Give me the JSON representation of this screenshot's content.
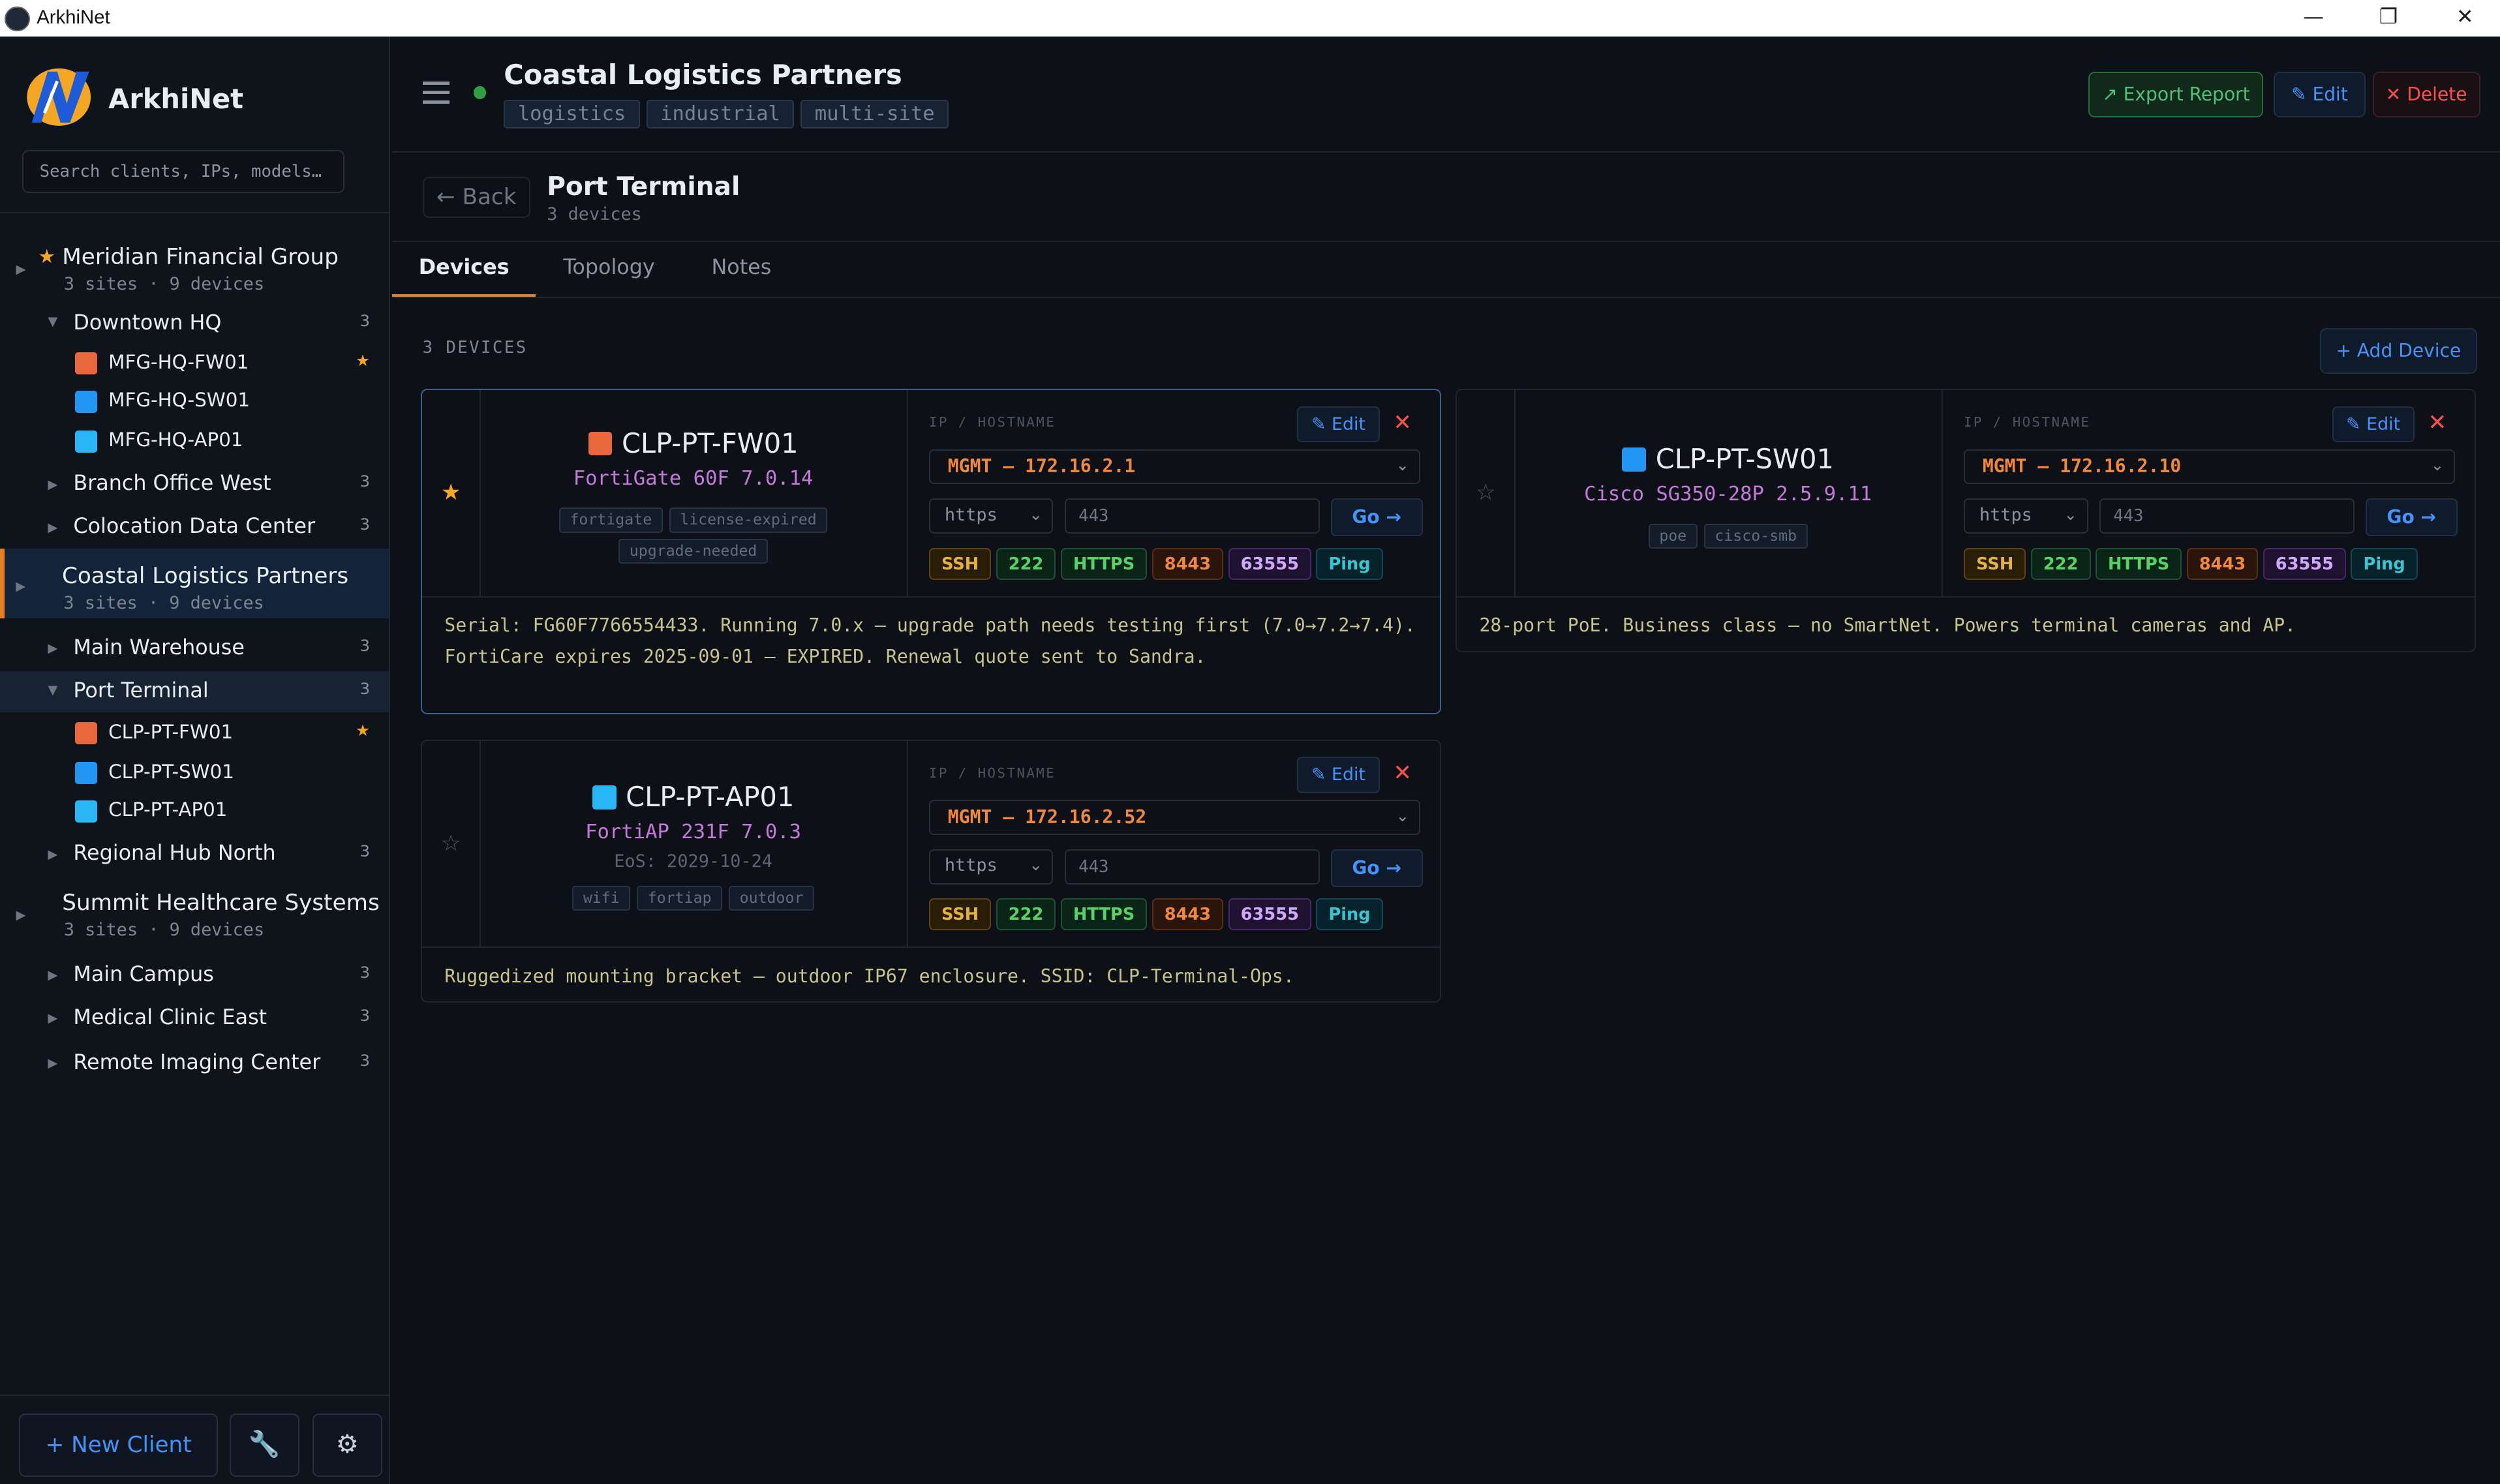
{
  "window": {
    "title": "ArkhiNet",
    "minimize": "—",
    "maximize": "❐",
    "close": "✕"
  },
  "sidebar": {
    "brand": "ArkhiNet",
    "search_placeholder": "Search clients, IPs, models…",
    "clients": [
      {
        "name": "Meridian Financial Group",
        "meta": "3 sites · 9 devices",
        "starred": true
      },
      {
        "name": "Coastal Logistics Partners",
        "meta": "3 sites · 9 devices",
        "starred": false
      },
      {
        "name": "Summit Healthcare Systems",
        "meta": "3 sites · 9 devices",
        "starred": false
      }
    ],
    "sites": {
      "downtown_hq": {
        "name": "Downtown HQ",
        "count": "3"
      },
      "branch_office_west": {
        "name": "Branch Office West",
        "count": "3"
      },
      "colocation": {
        "name": "Colocation Data Center",
        "count": "3"
      },
      "main_warehouse": {
        "name": "Main Warehouse",
        "count": "3"
      },
      "port_terminal": {
        "name": "Port Terminal",
        "count": "3"
      },
      "regional_hub_north": {
        "name": "Regional Hub North",
        "count": "3"
      },
      "main_campus": {
        "name": "Main Campus",
        "count": "3"
      },
      "medical_clinic_east": {
        "name": "Medical Clinic East",
        "count": "3"
      },
      "remote_imaging": {
        "name": "Remote Imaging Center",
        "count": "3"
      }
    },
    "devices": {
      "mfg_fw": "MFG-HQ-FW01",
      "mfg_sw": "MFG-HQ-SW01",
      "mfg_ap": "MFG-HQ-AP01",
      "clp_fw": "CLP-PT-FW01",
      "clp_sw": "CLP-PT-SW01",
      "clp_ap": "CLP-PT-AP01"
    },
    "footer": {
      "new_client": "+ New Client",
      "tools_icon": "🔧",
      "settings_icon": "⚙"
    }
  },
  "header": {
    "title": "Coastal Logistics Partners",
    "tags": [
      "logistics",
      "industrial",
      "multi-site"
    ],
    "export_label": "↗ Export Report",
    "edit_label": "✎ Edit",
    "delete_label": "✕ Delete"
  },
  "site": {
    "back_label": "← Back",
    "title": "Port Terminal",
    "subtitle": "3 devices"
  },
  "tabs": [
    "Devices",
    "Topology",
    "Notes"
  ],
  "devices_section": {
    "count_label": "3 DEVICES",
    "add_label": "+ Add Device"
  },
  "cards": [
    {
      "name": "CLP-PT-FW01",
      "model": "FortiGate 60F 7.0.14",
      "eos": "",
      "starred": true,
      "tags": [
        "fortigate",
        "license-expired",
        "upgrade-needed"
      ],
      "ip_label": "IP / HOSTNAME",
      "mgmt": "MGMT — 172.16.2.1",
      "protocol": "https",
      "port": "443",
      "go": "Go →",
      "edit": "✎ Edit",
      "quick": [
        "SSH",
        "222",
        "HTTPS",
        "8443",
        "63555",
        "Ping"
      ],
      "notes": [
        "Serial: FG60F7766554433. Running 7.0.x — upgrade path needs testing first (7.0→7.2→7.4).",
        "FortiCare expires 2025-09-01 — EXPIRED. Renewal quote sent to Sandra."
      ]
    },
    {
      "name": "CLP-PT-SW01",
      "model": "Cisco SG350-28P 2.5.9.11",
      "eos": "",
      "starred": false,
      "tags": [
        "poe",
        "cisco-smb"
      ],
      "ip_label": "IP / HOSTNAME",
      "mgmt": "MGMT — 172.16.2.10",
      "protocol": "https",
      "port": "443",
      "go": "Go →",
      "edit": "✎ Edit",
      "quick": [
        "SSH",
        "222",
        "HTTPS",
        "8443",
        "63555",
        "Ping"
      ],
      "notes": [
        "28-port PoE. Business class — no SmartNet. Powers terminal cameras and AP."
      ]
    },
    {
      "name": "CLP-PT-AP01",
      "model": "FortiAP 231F 7.0.3",
      "eos": "EoS: 2029-10-24",
      "starred": false,
      "tags": [
        "wifi",
        "fortiap",
        "outdoor"
      ],
      "ip_label": "IP / HOSTNAME",
      "mgmt": "MGMT — 172.16.2.52",
      "protocol": "https",
      "port": "443",
      "go": "Go →",
      "edit": "✎ Edit",
      "quick": [
        "SSH",
        "222",
        "HTTPS",
        "8443",
        "63555",
        "Ping"
      ],
      "notes": [
        "Ruggedized mounting bracket — outdoor IP67 enclosure. SSID: CLP-Terminal-Ops."
      ]
    }
  ],
  "colors": {
    "accent": "#e67e22",
    "link": "#4493f8",
    "status_online": "#2ea043",
    "firewall": "#e8673c",
    "switch": "#2196f3",
    "ap": "#29b6f6"
  },
  "icons": {
    "firewall": "firewall-icon",
    "switch": "switch-icon",
    "ap": "wifi-icon",
    "star": "★",
    "star_empty": "☆",
    "close": "✕",
    "chevron": "⌄",
    "caret_right": "▶",
    "caret_down": "▼"
  }
}
